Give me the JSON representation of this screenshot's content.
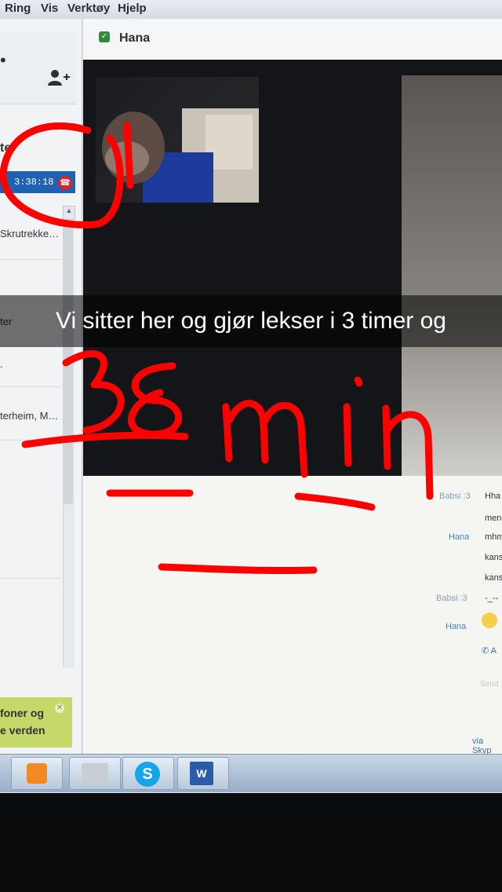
{
  "menu": [
    "Ring",
    "Vis",
    "Verktøy",
    "Hjelp"
  ],
  "conversation": {
    "contact_name": "Hana"
  },
  "sidebar": {
    "recent_header": "te",
    "call_timer": "3:38:18",
    "items": [
      "Skrutrekke…",
      "ter",
      ".",
      "terheim, M…"
    ]
  },
  "ad": {
    "line1": "foner og",
    "line2": "e verden"
  },
  "chat": {
    "messages": [
      {
        "sender": "Babsi :3",
        "text": "Hha"
      },
      {
        "sender": "",
        "text": "men"
      },
      {
        "sender": "Hana",
        "text": "mhm"
      },
      {
        "sender": "",
        "text": "kans"
      },
      {
        "sender": "",
        "text": "kans"
      },
      {
        "sender": "Babsi :3",
        "text": "-_--"
      },
      {
        "sender": "Hana",
        "text": ""
      },
      {
        "sender": "",
        "text": "A"
      }
    ],
    "input_hint": "Send",
    "via": "via Skyp"
  },
  "taskbar": {
    "apps": [
      "media-player-icon",
      "explorer-icon",
      "skype-icon",
      "word-icon"
    ]
  },
  "snap": {
    "caption": "Vi sitter her og gjør lekser i 3 timer og",
    "scribble": "38 min",
    "ink_color": "#ff0000"
  }
}
